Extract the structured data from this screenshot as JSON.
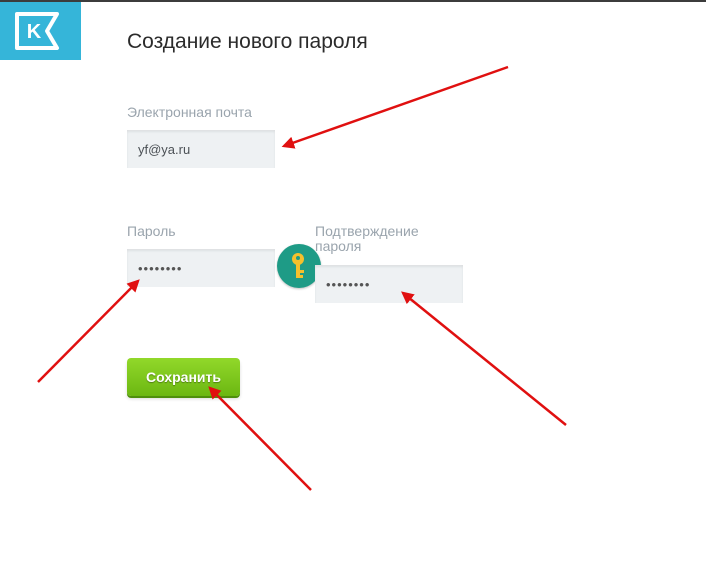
{
  "brand": {
    "logo_letter": "K",
    "logo_color": "#35b5d9"
  },
  "page": {
    "title": "Создание нового пароля"
  },
  "form": {
    "email_label": "Электронная почта",
    "email_value": "yf@ya.ru",
    "password_label": "Пароль",
    "password_value": "••••••••",
    "confirm_label_line1": "Подтверждение",
    "confirm_label_line2": "пароля",
    "confirm_value": "••••••••",
    "save_label": "Сохранить"
  },
  "colors": {
    "accent_green": "#7cc81a",
    "key_button": "#1e9b86",
    "key_icon": "#f5c02c",
    "annotation_arrow": "#e01010"
  },
  "icons": {
    "key_button_icon": "key-icon"
  }
}
